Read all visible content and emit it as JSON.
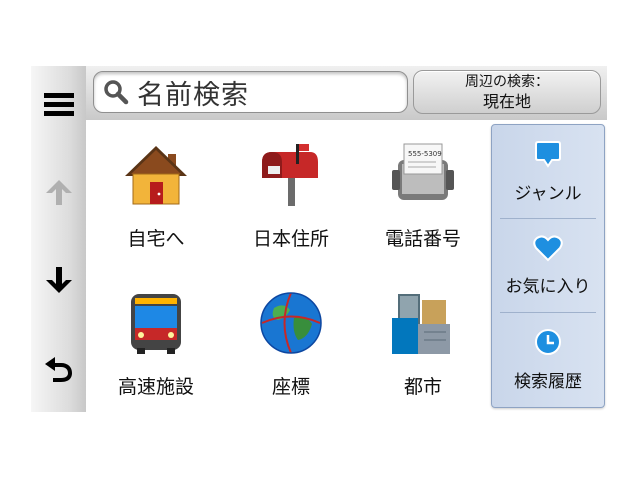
{
  "left_bar": {
    "menu_icon": "menu-icon",
    "up_icon": "arrow-up-icon",
    "down_icon": "arrow-down-icon",
    "back_icon": "back-icon"
  },
  "search": {
    "label": "名前検索",
    "icon": "search-icon"
  },
  "nearby": {
    "line1": "周辺の検索：",
    "line2": "現在地"
  },
  "tiles": [
    {
      "label": "自宅へ",
      "icon": "home-icon"
    },
    {
      "label": "日本住所",
      "icon": "mailbox-icon"
    },
    {
      "label": "電話番号",
      "icon": "rolodex-icon"
    },
    {
      "label": "高速施設",
      "icon": "bus-icon"
    },
    {
      "label": "座標",
      "icon": "globe-icon"
    },
    {
      "label": "都市",
      "icon": "city-icon"
    }
  ],
  "right_panel": [
    {
      "label": "ジャンル",
      "icon": "chat-pin-icon"
    },
    {
      "label": "お気に入り",
      "icon": "heart-icon"
    },
    {
      "label": "検索履歴",
      "icon": "clock-icon"
    }
  ],
  "colors": {
    "accent_blue": "#1e8fe0",
    "panel_bg": "#d0dcee"
  }
}
